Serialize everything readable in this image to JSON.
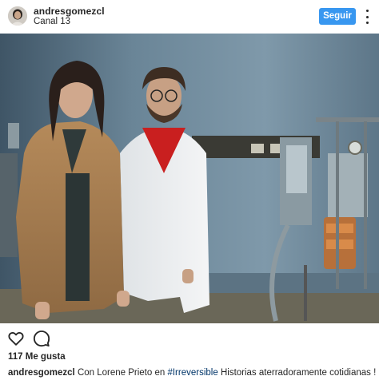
{
  "header": {
    "username": "andresgomezcl",
    "location": "Canal 13",
    "follow_label": "Seguir"
  },
  "post": {
    "likes_text": "117 Me gusta",
    "caption": {
      "username": "andresgomezcl",
      "text_before": "Con Lorene Prieto en",
      "hashtag": "#Irreversible",
      "text_after": "Historias aterradoramente cotidianas !"
    }
  },
  "icons": {
    "avatar": "avatar-photo",
    "like": "heart-outline-icon",
    "comment": "speech-bubble-icon",
    "more": "more-options-icon"
  },
  "colors": {
    "follow_button": "#3897f0",
    "hashtag": "#003569",
    "text": "#262626"
  }
}
